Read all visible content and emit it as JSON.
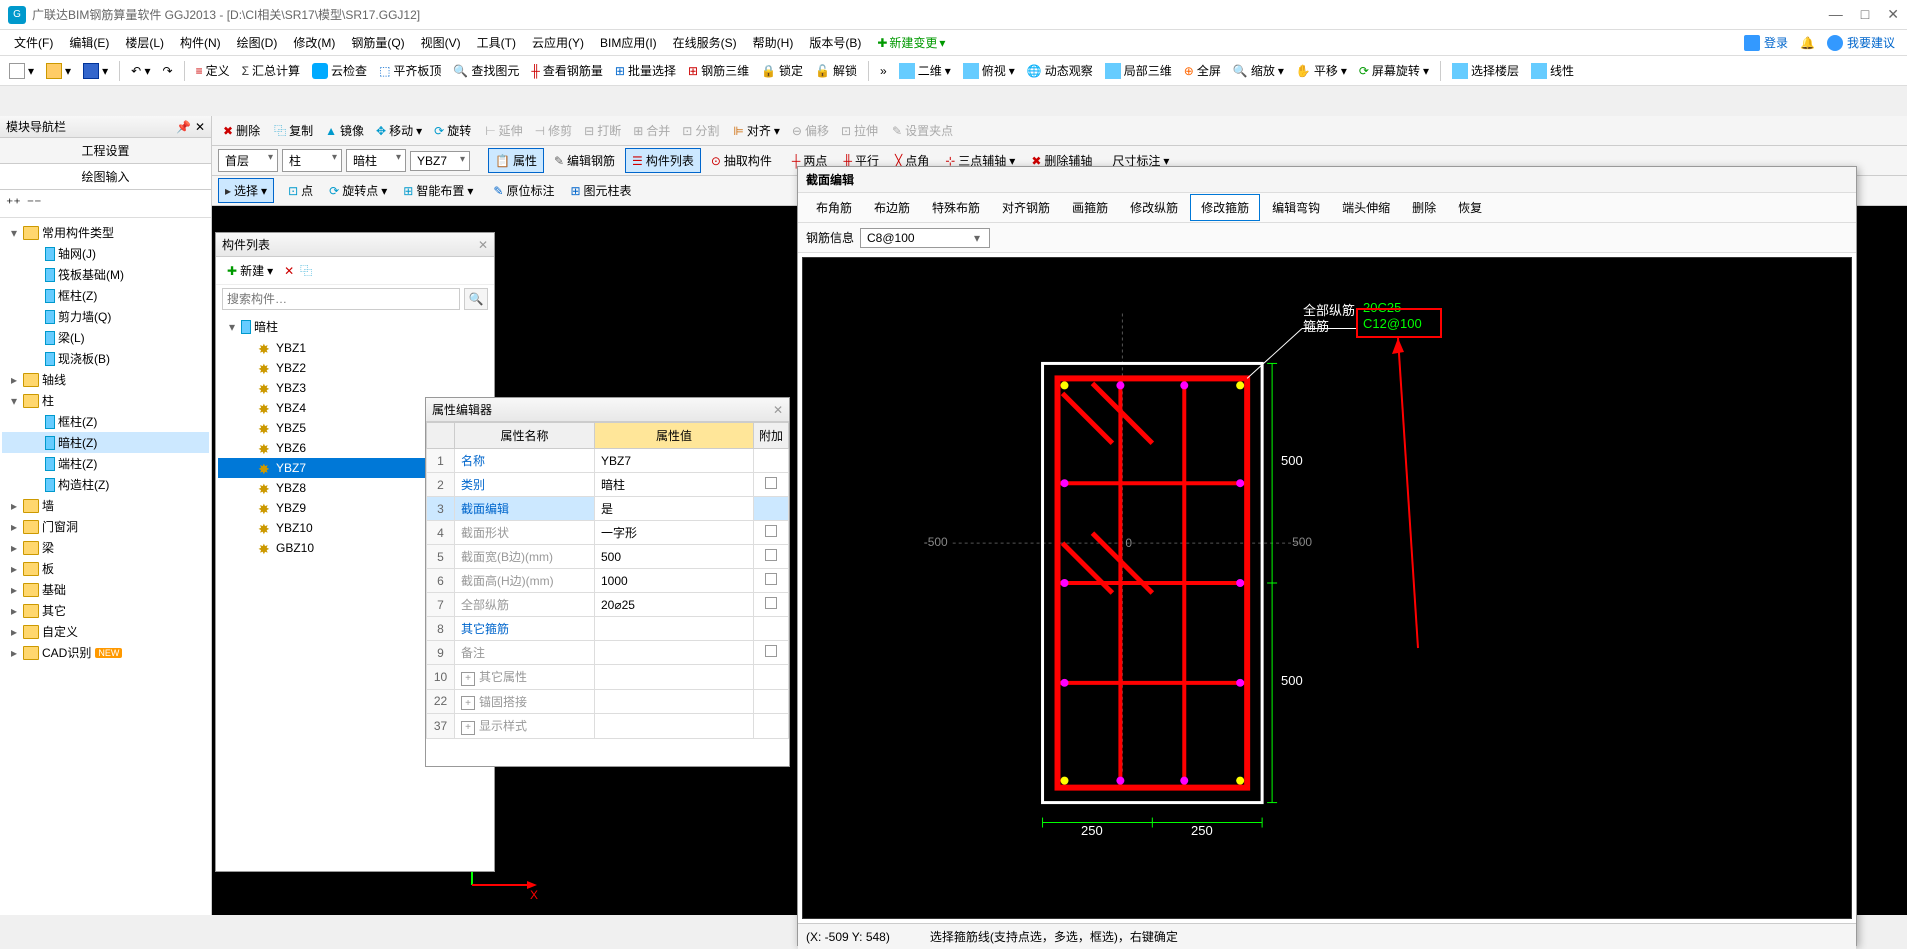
{
  "title": "广联达BIM钢筋算量软件 GGJ2013 - [D:\\CI相关\\SR17\\模型\\SR17.GGJ12]",
  "menu": [
    "文件(F)",
    "编辑(E)",
    "楼层(L)",
    "构件(N)",
    "绘图(D)",
    "修改(M)",
    "钢筋量(Q)",
    "视图(V)",
    "工具(T)",
    "云应用(Y)",
    "BIM应用(I)",
    "在线服务(S)",
    "帮助(H)",
    "版本号(B)"
  ],
  "menu_new": "新建变更",
  "menu_right": {
    "login": "登录",
    "suggest": "我要建议"
  },
  "tb1": [
    "定义",
    "汇总计算",
    "云检查",
    "平齐板顶",
    "查找图元",
    "查看钢筋量",
    "批量选择",
    "钢筋三维",
    "锁定",
    "解锁"
  ],
  "tb1_right": [
    "二维",
    "俯视",
    "动态观察",
    "局部三维",
    "全屏",
    "缩放",
    "平移",
    "屏幕旋转",
    "选择楼层",
    "线性"
  ],
  "edit_tb": [
    "删除",
    "复制",
    "镜像",
    "移动",
    "旋转",
    "延伸",
    "修剪",
    "打断",
    "合并",
    "分割",
    "对齐",
    "偏移",
    "拉伸",
    "设置夹点"
  ],
  "selectors": {
    "floor": "首层",
    "cat": "柱",
    "sub": "暗柱",
    "comp": "YBZ7"
  },
  "sel_btns": [
    "属性",
    "编辑钢筋",
    "构件列表",
    "抽取构件",
    "两点",
    "平行",
    "点角",
    "三点辅轴",
    "删除辅轴",
    "尺寸标注"
  ],
  "act_btns": [
    "选择",
    "点",
    "旋转点",
    "智能布置",
    "原位标注",
    "图元柱表"
  ],
  "nav": {
    "header": "模块导航栏",
    "tabs": [
      "工程设置",
      "绘图输入"
    ],
    "tree": [
      {
        "t": "常用构件类型",
        "lvl": 0,
        "exp": true,
        "icon": "folder"
      },
      {
        "t": "轴网(J)",
        "lvl": 1,
        "icon": "grid"
      },
      {
        "t": "筏板基础(M)",
        "lvl": 1,
        "icon": "grid"
      },
      {
        "t": "框柱(Z)",
        "lvl": 1,
        "icon": "col"
      },
      {
        "t": "剪力墙(Q)",
        "lvl": 1,
        "icon": "col"
      },
      {
        "t": "梁(L)",
        "lvl": 1,
        "icon": "col"
      },
      {
        "t": "现浇板(B)",
        "lvl": 1,
        "icon": "col"
      },
      {
        "t": "轴线",
        "lvl": 0,
        "icon": "folder"
      },
      {
        "t": "柱",
        "lvl": 0,
        "exp": true,
        "icon": "folder"
      },
      {
        "t": "框柱(Z)",
        "lvl": 1,
        "icon": "col"
      },
      {
        "t": "暗柱(Z)",
        "lvl": 1,
        "icon": "col",
        "sel": true
      },
      {
        "t": "端柱(Z)",
        "lvl": 1,
        "icon": "col"
      },
      {
        "t": "构造柱(Z)",
        "lvl": 1,
        "icon": "col"
      },
      {
        "t": "墙",
        "lvl": 0,
        "icon": "folder"
      },
      {
        "t": "门窗洞",
        "lvl": 0,
        "icon": "folder"
      },
      {
        "t": "梁",
        "lvl": 0,
        "icon": "folder"
      },
      {
        "t": "板",
        "lvl": 0,
        "icon": "folder"
      },
      {
        "t": "基础",
        "lvl": 0,
        "icon": "folder"
      },
      {
        "t": "其它",
        "lvl": 0,
        "icon": "folder"
      },
      {
        "t": "自定义",
        "lvl": 0,
        "icon": "folder"
      },
      {
        "t": "CAD识别",
        "lvl": 0,
        "icon": "folder",
        "new": true
      }
    ]
  },
  "comp": {
    "title": "构件列表",
    "new_btn": "新建",
    "search_ph": "搜索构件…",
    "root": "暗柱",
    "items": [
      "YBZ1",
      "YBZ2",
      "YBZ3",
      "YBZ4",
      "YBZ5",
      "YBZ6",
      "YBZ7",
      "YBZ8",
      "YBZ9",
      "YBZ10",
      "GBZ10"
    ],
    "selected": "YBZ7"
  },
  "prop": {
    "title": "属性编辑器",
    "headers": [
      "属性名称",
      "属性值",
      "附加"
    ],
    "rows": [
      {
        "n": "1",
        "name": "名称",
        "val": "YBZ7",
        "link": true
      },
      {
        "n": "2",
        "name": "类别",
        "val": "暗柱",
        "link": true,
        "chk": true
      },
      {
        "n": "3",
        "name": "截面编辑",
        "val": "是",
        "link": true,
        "sel": true
      },
      {
        "n": "4",
        "name": "截面形状",
        "val": "一字形",
        "gray": true,
        "chk": true
      },
      {
        "n": "5",
        "name": "截面宽(B边)(mm)",
        "val": "500",
        "gray": true,
        "chk": true
      },
      {
        "n": "6",
        "name": "截面高(H边)(mm)",
        "val": "1000",
        "gray": true,
        "chk": true
      },
      {
        "n": "7",
        "name": "全部纵筋",
        "val": "20⌀25",
        "gray": true,
        "chk": true
      },
      {
        "n": "8",
        "name": "其它箍筋",
        "val": "",
        "link": true
      },
      {
        "n": "9",
        "name": "备注",
        "val": "",
        "gray": true,
        "chk": true
      },
      {
        "n": "10",
        "name": "其它属性",
        "val": "",
        "gray": true,
        "exp": true
      },
      {
        "n": "22",
        "name": "锚固搭接",
        "val": "",
        "gray": true,
        "exp": true
      },
      {
        "n": "37",
        "name": "显示样式",
        "val": "",
        "gray": true,
        "exp": true
      }
    ]
  },
  "sect": {
    "title": "截面编辑",
    "tabs": [
      "布角筋",
      "布边筋",
      "特殊布筋",
      "对齐钢筋",
      "画箍筋",
      "修改纵筋",
      "修改箍筋",
      "编辑弯钩",
      "端头伸缩",
      "删除",
      "恢复"
    ],
    "active_tab": "修改箍筋",
    "info_label": "钢筋信息",
    "info_val": "C8@100",
    "anno_all": "全部纵筋",
    "anno_stir": "箍筋",
    "anno_val1": "20C25",
    "anno_val2": "C12@100",
    "dim_500a": "500",
    "dim_500b": "500",
    "dim_250a": "250",
    "dim_250b": "250",
    "dim_neg500": "-500",
    "dim_pos500": "500",
    "dim_zero": "0",
    "coords": "(X: -509 Y: 548)",
    "hint": "选择箍筋线(支持点选，多选，框选)，右键确定"
  }
}
